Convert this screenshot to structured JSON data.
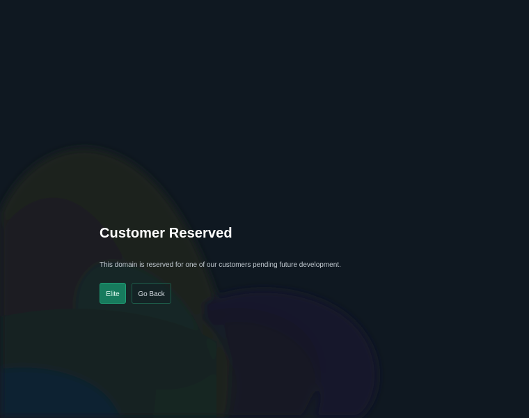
{
  "page": {
    "title": "Customer Reserved",
    "description": "This domain is reserved for one of our customers pending future development.",
    "actions": {
      "primary_label": "Elite",
      "secondary_label": "Go Back"
    }
  },
  "colors": {
    "background": "#0f1821",
    "primary_button": "#177b5d",
    "secondary_border": "#1d5d4a"
  }
}
